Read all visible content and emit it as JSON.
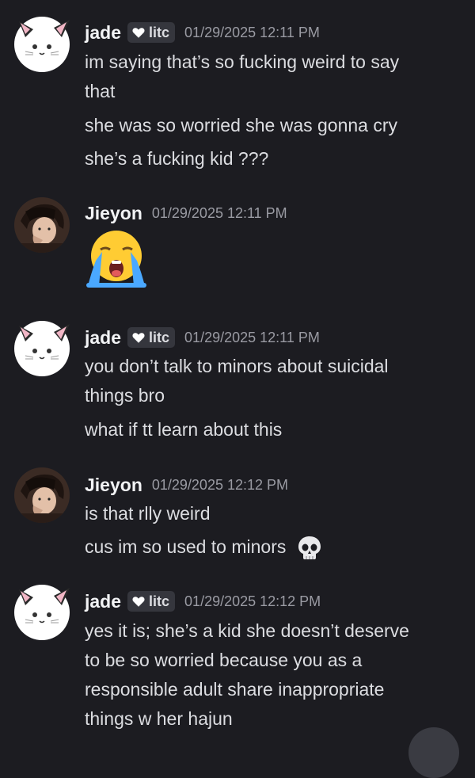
{
  "messages": [
    {
      "author": "jade",
      "tag": "litc",
      "timestamp": "01/29/2025 12:11 PM",
      "lines": [
        "im saying that’s so fucking weird to say",
        "that",
        "she was so worried she was gonna cry",
        "she’s a fucking kid ???"
      ]
    },
    {
      "author": "Jieyon",
      "timestamp": "01/29/2025 12:11 PM",
      "emoji": "loudly-crying-face-emoji"
    },
    {
      "author": "jade",
      "tag": "litc",
      "timestamp": "01/29/2025 12:11 PM",
      "lines": [
        "you don’t talk to minors about suicidal",
        "things bro",
        "what if tt learn about this"
      ]
    },
    {
      "author": "Jieyon",
      "timestamp": "01/29/2025 12:12 PM",
      "lines": [
        "is that rlly weird",
        "cus im so used to minors"
      ],
      "inline_emoji": "skull-emoji"
    },
    {
      "author": "jade",
      "tag": "litc",
      "timestamp": "01/29/2025 12:12 PM",
      "lines": [
        "yes it is; she’s a kid she doesn’t deserve",
        "to be so worried because you as a",
        "responsible adult share inappropriate",
        "things w her hajun"
      ]
    }
  ],
  "colors": {
    "background": "#1c1c21",
    "username": "#f2f3f5",
    "text": "#dcdde1",
    "timestamp": "#9a9ba3",
    "tag_background": "#35363d"
  },
  "icons": {
    "tag_icon": "heart-icon",
    "scroll_button": "jump-to-present-button"
  }
}
